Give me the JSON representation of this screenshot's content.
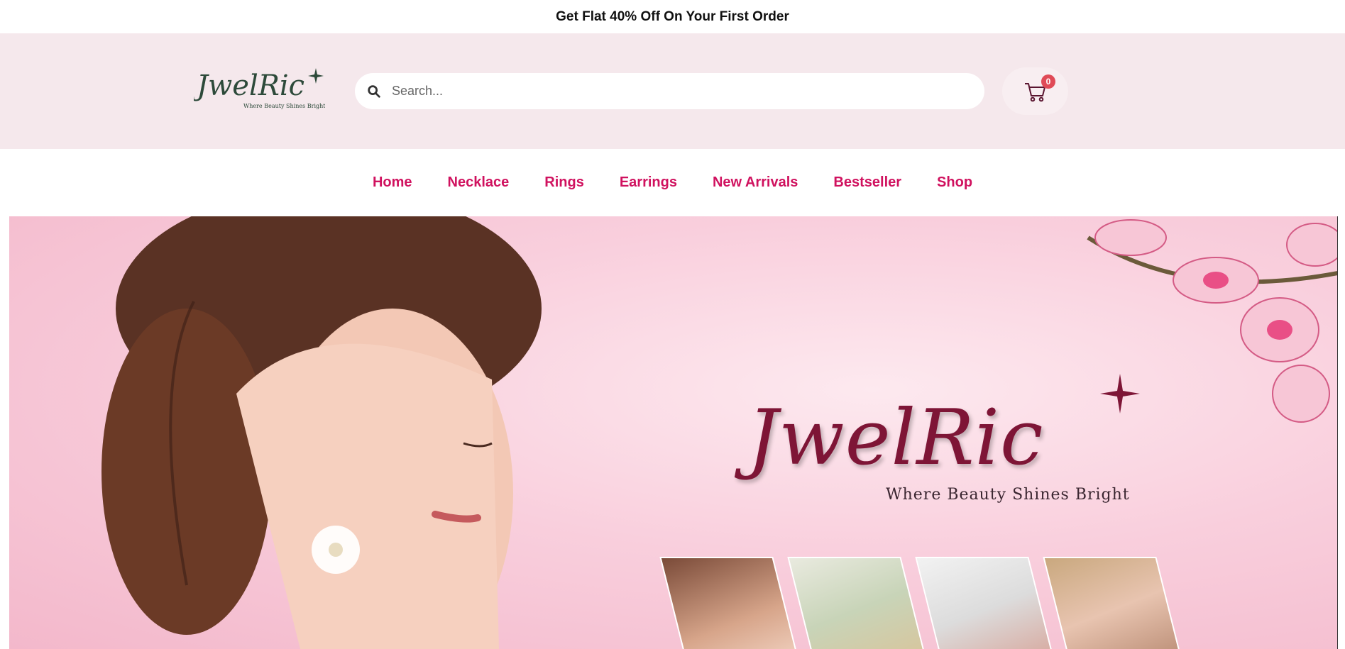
{
  "announcement": {
    "text": "Get Flat 40% Off On Your First Order"
  },
  "header": {
    "logo": {
      "wordmark": "JwelRic",
      "tagline": "Where Beauty Shines Bright"
    },
    "search": {
      "placeholder": "Search...",
      "value": ""
    },
    "cart": {
      "count": "0",
      "icon": "cart-icon"
    }
  },
  "nav": {
    "items": [
      {
        "label": "Home"
      },
      {
        "label": "Necklace"
      },
      {
        "label": "Rings"
      },
      {
        "label": "Earrings"
      },
      {
        "label": "New Arrivals"
      },
      {
        "label": "Bestseller"
      },
      {
        "label": "Shop"
      }
    ]
  },
  "hero": {
    "brand": "JwelRic",
    "tagline": "Where Beauty Shines Bright",
    "tiles": [
      "necklace-photo",
      "rings-photo",
      "bracelet-photo",
      "earrings-photo"
    ]
  },
  "colors": {
    "accent": "#d0125f",
    "header_bg": "#f5e8ec",
    "brand_maroon": "#7e1536",
    "badge": "#e04a57"
  }
}
